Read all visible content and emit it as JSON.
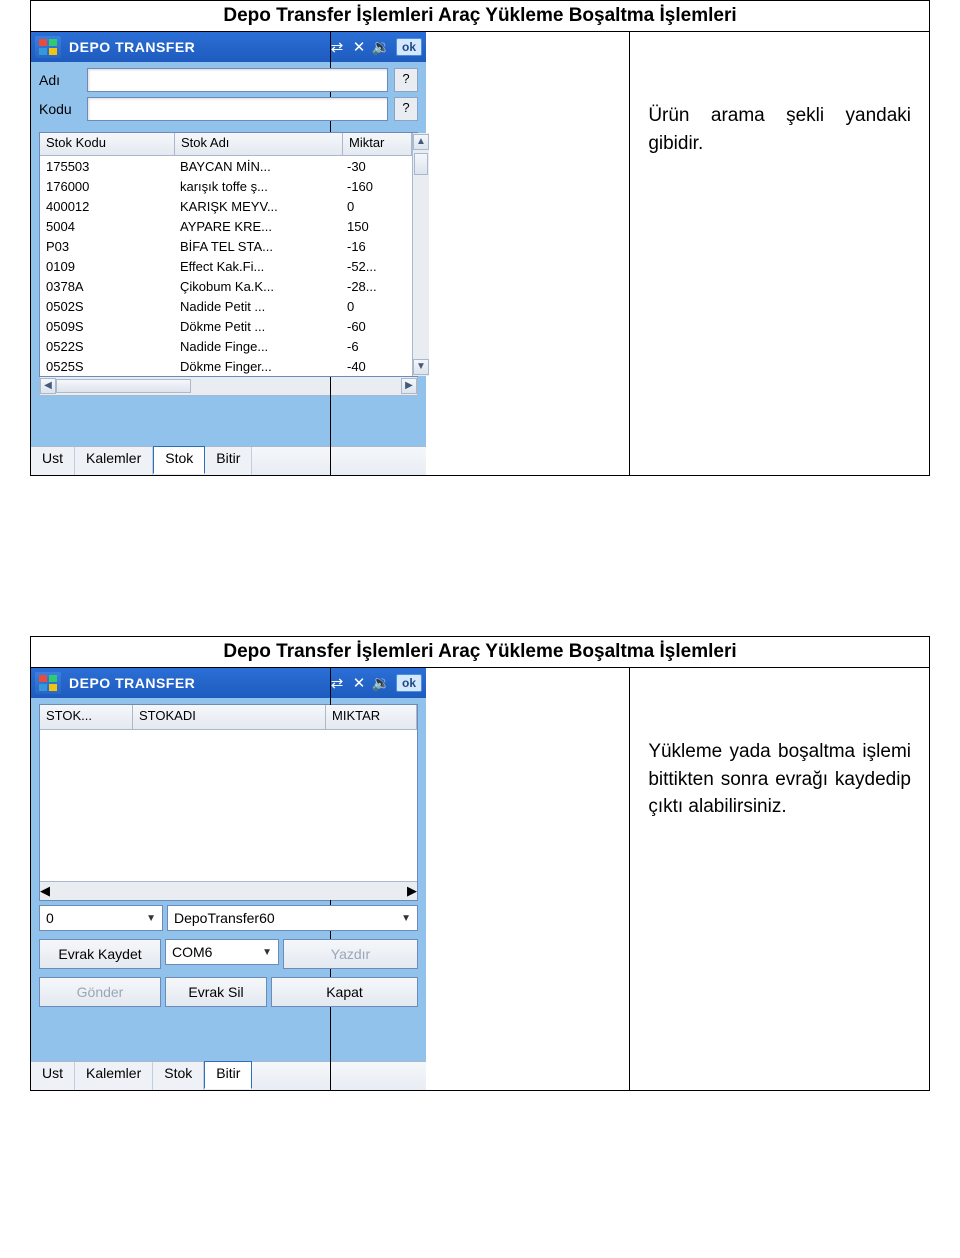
{
  "section1": {
    "heading": "Depo Transfer İşlemleri Araç Yükleme Boşaltma İşlemleri",
    "desc": "Ürün arama şekli yandaki gibidir.",
    "pda": {
      "title": "DEPO TRANSFER",
      "ok": "ok",
      "field_adi": "Adı",
      "field_kodu": "Kodu",
      "q": "?",
      "columns": {
        "c1": "Stok Kodu",
        "c2": "Stok Adı",
        "c3": "Miktar"
      },
      "rows": [
        {
          "code": "175503",
          "name": "BAYCAN MİN...",
          "qty": "-30"
        },
        {
          "code": "176000",
          "name": "karışık toffe ş...",
          "qty": "-160"
        },
        {
          "code": "400012",
          "name": "KARIŞK MEYV...",
          "qty": "0"
        },
        {
          "code": "5004",
          "name": "AYPARE KRE...",
          "qty": "150"
        },
        {
          "code": "P03",
          "name": "BİFA TEL STA...",
          "qty": "-16"
        },
        {
          "code": "0109",
          "name": "Effect Kak.Fi...",
          "qty": "-52..."
        },
        {
          "code": "0378A",
          "name": "Çikobum Ka.K...",
          "qty": "-28..."
        },
        {
          "code": "0502S",
          "name": "Nadide Petit ...",
          "qty": "0"
        },
        {
          "code": "0509S",
          "name": "Dökme Petit ...",
          "qty": "-60"
        },
        {
          "code": "0522S",
          "name": "Nadide Finge...",
          "qty": "-6"
        },
        {
          "code": "0525S",
          "name": "Dökme Finger...",
          "qty": "-40"
        }
      ],
      "tabs": {
        "ust": "Ust",
        "kalemler": "Kalemler",
        "stok": "Stok",
        "bitir": "Bitir"
      }
    }
  },
  "section2": {
    "heading": "Depo Transfer İşlemleri Araç Yükleme Boşaltma İşlemleri",
    "desc": "Yükleme yada boşaltma işlemi bittikten sonra evrağı kaydedip çıktı alabilirsiniz.",
    "pda": {
      "title": "DEPO TRANSFER",
      "ok": "ok",
      "columns": {
        "c1": "STOK...",
        "c2": "STOKADI",
        "c3": "MIKTAR"
      },
      "dd_left": "0",
      "dd_right": "DepoTransfer60",
      "dd_com": "COM6",
      "btn_save": "Evrak Kaydet",
      "btn_print": "Yazdır",
      "btn_send": "Gönder",
      "btn_del": "Evrak Sil",
      "btn_close": "Kapat",
      "tabs": {
        "ust": "Ust",
        "kalemler": "Kalemler",
        "stok": "Stok",
        "bitir": "Bitir"
      }
    }
  }
}
